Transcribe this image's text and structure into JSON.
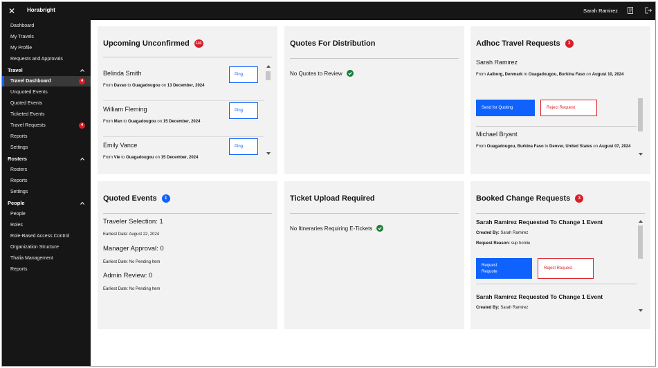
{
  "topbar": {
    "brand": "Horabright",
    "user": "Sarah Ramirez",
    "icons": [
      "close-icon",
      "document-icon",
      "logout-icon"
    ]
  },
  "sidebar": {
    "top_items": [
      "Dashboard",
      "My Travels",
      "My Profile",
      "Requests and Approvals"
    ],
    "travel_section": "Travel",
    "travel_items": [
      {
        "label": "Travel Dashboard",
        "badge": "4"
      },
      {
        "label": "Unquoted Events"
      },
      {
        "label": "Quoted Events"
      },
      {
        "label": "Ticketed Events"
      },
      {
        "label": "Travel Requests",
        "badge": "4"
      },
      {
        "label": "Reports"
      },
      {
        "label": "Settings"
      }
    ],
    "rosters_section": "Rosters",
    "rosters_items": [
      "Rosters",
      "Reports",
      "Settings"
    ],
    "people_section": "People",
    "people_items": [
      "People",
      "Roles",
      "Role-Based Access Control",
      "Organization Structure",
      "Thalia Management",
      "Reports"
    ]
  },
  "upcoming": {
    "title": "Upcoming Unconfirmed",
    "badge": "110",
    "ping_label": "Ping",
    "from_word": "From",
    "to_word": "to",
    "on_word": "on",
    "rows": [
      {
        "name": "Belinda Smith",
        "from": "Davao",
        "to": "Ouagadougou",
        "date": "13 December, 2024"
      },
      {
        "name": "William Fleming",
        "from": "Man",
        "to": "Ouagadougou",
        "date": "15 December, 2024"
      },
      {
        "name": "Emily Vance",
        "from": "Vie",
        "to": "Ouagadougou",
        "date": "15 December, 2024"
      }
    ]
  },
  "quotes": {
    "title": "Quotes For Distribution",
    "empty": "No Quotes to Review"
  },
  "adhoc": {
    "title": "Adhoc Travel Requests",
    "badge": "3",
    "from_word": "From",
    "to_word": "to",
    "on_word": "on",
    "send_label": "Send for Quoting",
    "reject_label": "Reject Request",
    "items": [
      {
        "name": "Sarah Ramirez",
        "from": "Aalborg, Denmark",
        "to": "Ouagadougou, Burkina Faso",
        "date": "August 10, 2024"
      },
      {
        "name": "Michael Bryant",
        "from": "Ouagadougou, Burkina Faso",
        "to": "Denver, United States",
        "date": "August 07, 2024"
      }
    ]
  },
  "quoted": {
    "title": "Quoted Events",
    "badge": "1",
    "groups": [
      {
        "label": "Traveler Selection: 1",
        "sub": "Earliest Date: August 22, 2024"
      },
      {
        "label": "Manager Approval: 0",
        "sub": "Earliest Date: No Pending Item"
      },
      {
        "label": "Admin Review: 0",
        "sub": "Earliest Date: No Pending Item"
      }
    ]
  },
  "ticket": {
    "title": "Ticket Upload Required",
    "empty": "No Itineraries Requiring E-Tickets"
  },
  "booked": {
    "title": "Booked Change Requests",
    "badge": "3",
    "created_by_label": "Created By:",
    "reason_label": "Request Reason:",
    "requote_label": "Request Requote",
    "reject_label": "Reject Request",
    "items": [
      {
        "title": "Sarah Ramirez Requested To Change 1 Event",
        "created_by": "Sarah Ramirez",
        "reason": "sup homie"
      },
      {
        "title": "Sarah Ramirez Requested To Change 1 Event",
        "created_by": "Sarah Ramirez"
      }
    ]
  },
  "colors": {
    "accent": "#0f62fe",
    "danger": "#da1e28",
    "success": "#198038",
    "sidebar": "#161616"
  }
}
